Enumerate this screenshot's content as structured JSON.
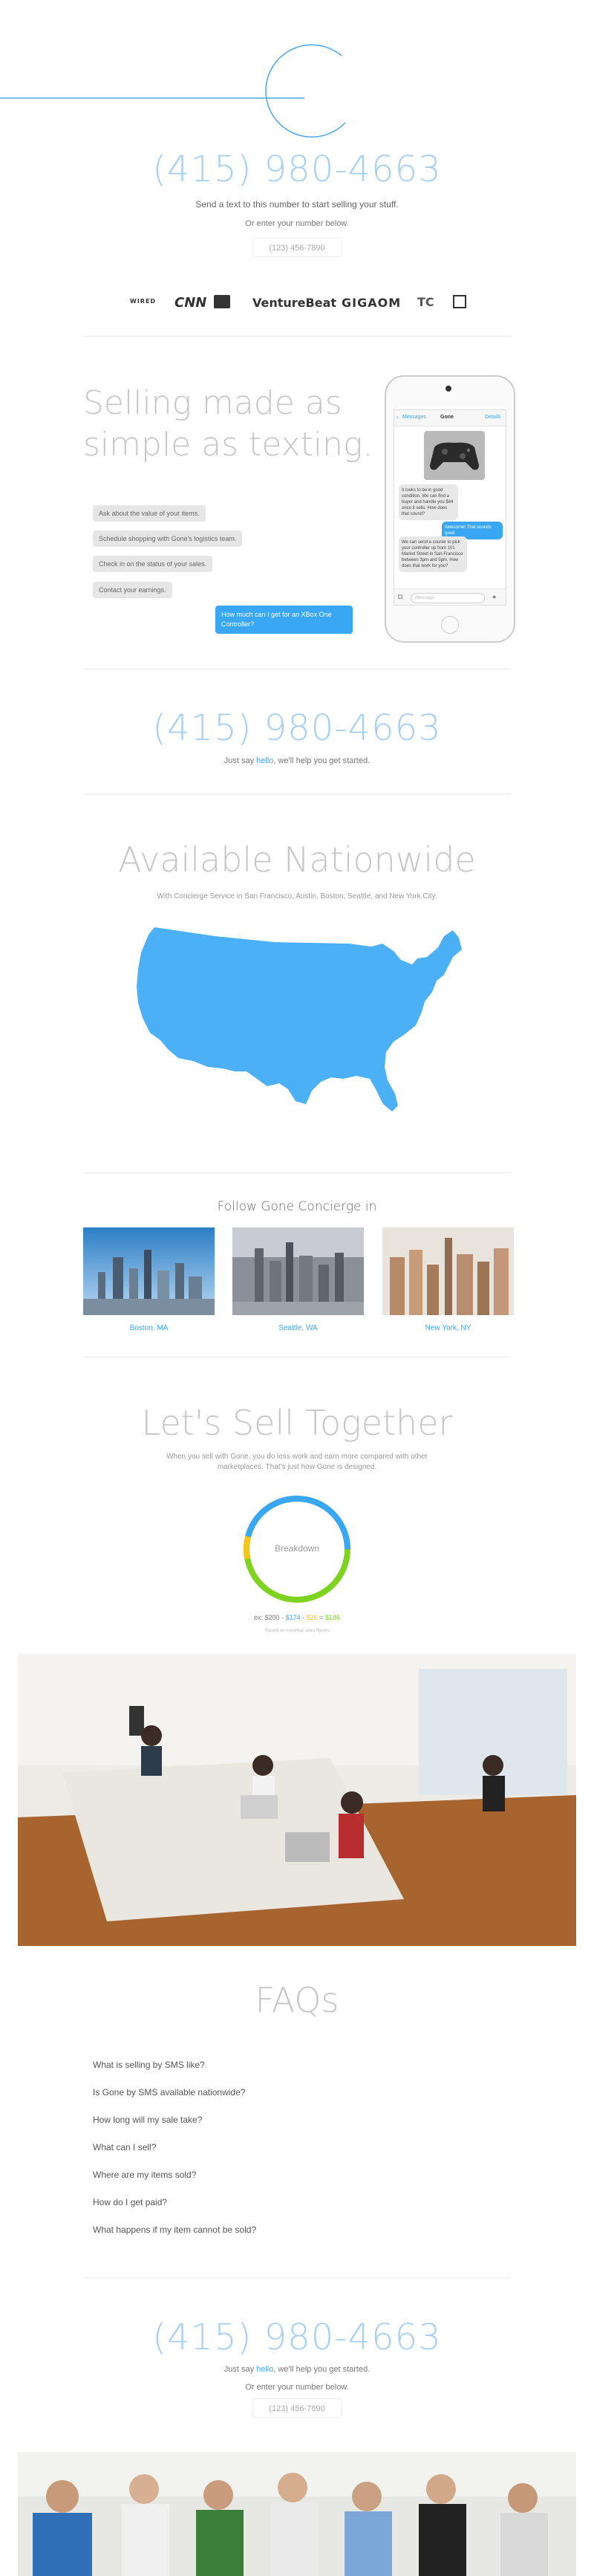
{
  "hero": {
    "logo_letter": "G",
    "phone": "(415) 980-4663",
    "tagline": "Send a text to this number to start selling your stuff.",
    "or_enter": "Or enter your number below.",
    "input_placeholder": "(123) 456-7890"
  },
  "press_logos": [
    "WIRED",
    "CNN",
    "TechCrunch",
    "VentureBeat",
    "GIGAOM",
    "TC",
    "Mashable"
  ],
  "selling": {
    "title_line1": "Selling made as",
    "title_line2": "simple as texting.",
    "steps": [
      "Ask about the value of your items.",
      "Schedule shopping with Gone's logistics team.",
      "Check in on the status of your sales.",
      "Contact your earnings."
    ],
    "question": "How much can I get for an XBox One Controller?"
  },
  "phone_mock": {
    "back_label": "Messages",
    "contact": "Gone",
    "details": "Details",
    "msg1": "It looks to be in good condition. We can find a buyer and handle you $44 once it sells. How does that sound?",
    "reply": "Awesome! That sounds good.",
    "msg2": "We can send a courier to pick your controller up from 101 Market Street in San Francisco between 3pm and 5pm. How does that work for you?",
    "input_placeholder": "iMessage"
  },
  "cta1": {
    "phone": "(415) 980-4663",
    "text_pre": "Just say ",
    "text_link": "hello",
    "text_post": ", we'll help you get started."
  },
  "nationwide": {
    "title": "Available Nationwide",
    "subtitle": "With Concierge Service in San Francisco, Austin, Boston, Seattle, and New York City.",
    "map_color": "#4cb0f7"
  },
  "follow": {
    "title": "Follow Gone Concierge in",
    "cities": [
      "Boston, MA",
      "Seattle, WA",
      "New York, NY"
    ]
  },
  "sell_together": {
    "title": "Let's Sell Together",
    "text_line1": "When you sell with Gone, you do less work and earn more compared with other",
    "text_line2": "marketplaces. That's just how Gone is designed.",
    "donut_label": "Breakdown",
    "breakdown_pre": "ex: ",
    "breakdown_total": "$200",
    "breakdown_a": "$174",
    "breakdown_b": "$26",
    "breakdown_c": "$186",
    "footnote": "*Based on historical sales figures"
  },
  "faqs": {
    "title": "FAQs",
    "items": [
      "What is selling by SMS like?",
      "Is Gone by SMS available nationwide?",
      "How long will my sale take?",
      "What can I sell?",
      "Where are my items sold?",
      "How do I get paid?",
      "What happens if my item cannot be sold?"
    ]
  },
  "cta2": {
    "phone": "(415) 980-4663",
    "text_pre": "Just say ",
    "text_link": "hello",
    "text_post": ", we'll help you get started.",
    "or_enter": "Or enter your number below.",
    "input_placeholder": "(123) 456-7890"
  },
  "colors": {
    "accent": "#3aa7f4",
    "phone_light": "#a8d0f5",
    "donut_blue": "#3aa7f4",
    "donut_green": "#7ed321",
    "donut_yellow": "#f5c518"
  }
}
